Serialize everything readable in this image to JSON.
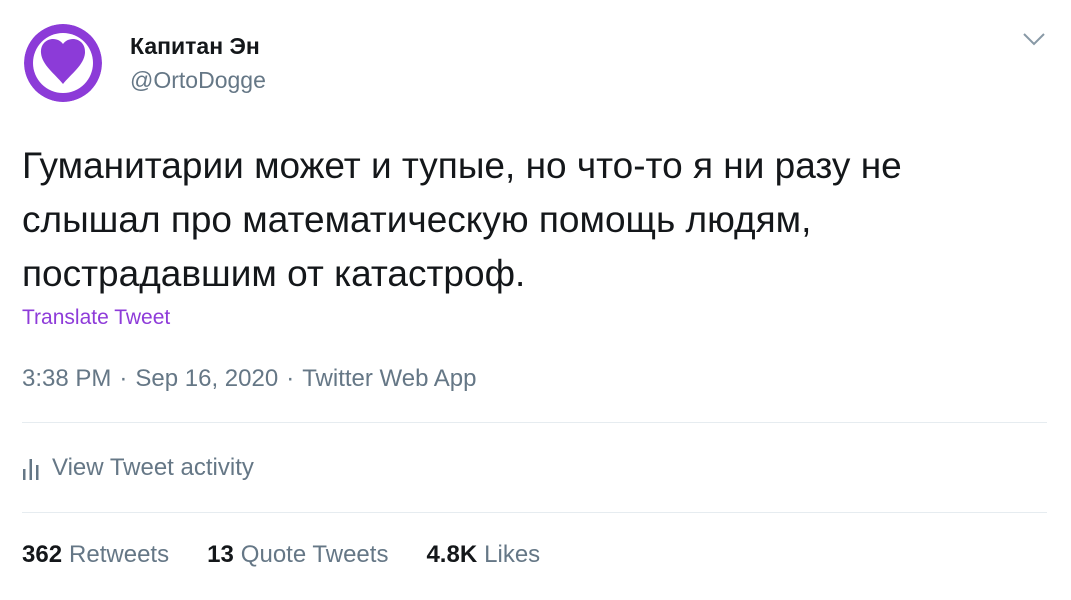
{
  "author": {
    "display_name": "Капитан Эн",
    "handle": "@OrtoDogge"
  },
  "tweet": {
    "text": "Гуманитарии может и тупые, но что-то я ни разу не слышал про математическую помощь людям, пострадавшим от катастроф.",
    "translate_label": "Translate Tweet",
    "time": "3:38 PM",
    "date": "Sep 16, 2020",
    "source": "Twitter Web App",
    "separator": "·"
  },
  "activity": {
    "label": "View Tweet activity"
  },
  "stats": [
    {
      "value": "362",
      "label": "Retweets"
    },
    {
      "value": "13",
      "label": "Quote Tweets"
    },
    {
      "value": "4.8K",
      "label": "Likes"
    }
  ],
  "icons": {
    "avatar": "purple-heart-avatar",
    "caret": "chevron-down-icon",
    "activity": "bar-chart-icon"
  },
  "colors": {
    "accent": "#8e3bd9",
    "avatar_purple": "#8c3bd8",
    "muted_text": "#657786",
    "main_text": "#14171a"
  }
}
